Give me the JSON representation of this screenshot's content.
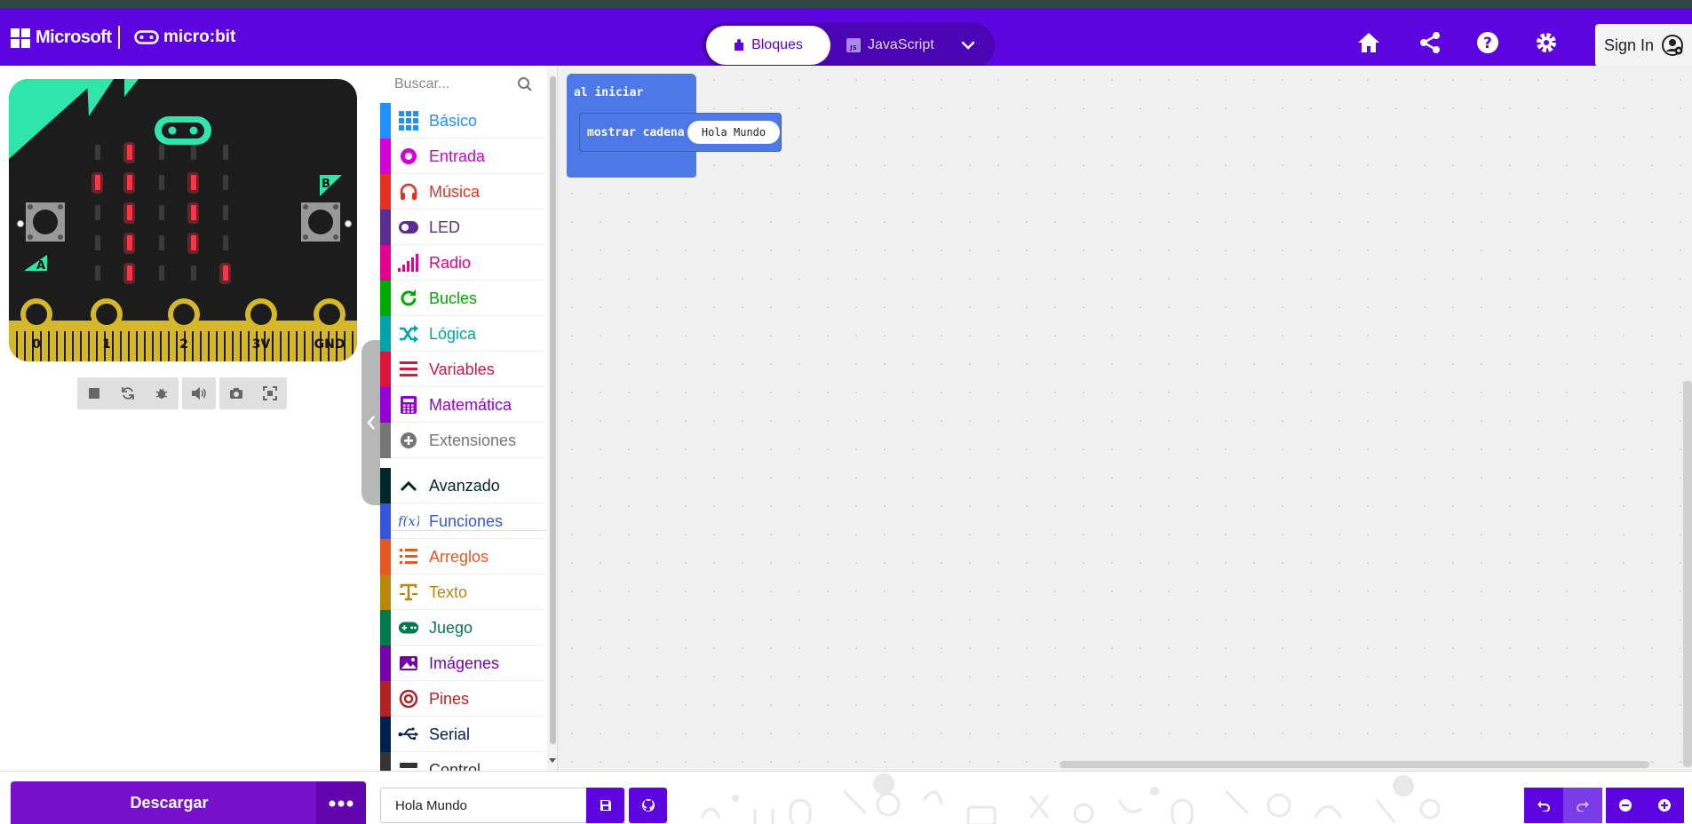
{
  "header": {
    "brand": "Microsoft",
    "product": "micro:bit",
    "modes": [
      {
        "label": "Bloques",
        "active": true
      },
      {
        "label": "JavaScript",
        "active": false
      }
    ],
    "sign_in": "Sign In",
    "icons": [
      "home-icon",
      "share-icon",
      "help-icon",
      "settings-icon",
      "user-icon"
    ]
  },
  "simulator": {
    "pins": [
      "0",
      "1",
      "2",
      "3V",
      "GND"
    ],
    "button_a": "A",
    "button_b": "B",
    "led_grid": [
      [
        0,
        1,
        0,
        0,
        0
      ],
      [
        1,
        1,
        0,
        1,
        0
      ],
      [
        0,
        1,
        0,
        1,
        0
      ],
      [
        0,
        1,
        0,
        1,
        0
      ],
      [
        0,
        1,
        0,
        0,
        1
      ]
    ],
    "controls": [
      "stop-icon",
      "restart-icon",
      "debug-icon",
      "sound-icon",
      "screenshot-icon",
      "fullscreen-icon"
    ]
  },
  "toolbox": {
    "search_placeholder": "Buscar...",
    "categories": [
      {
        "label": "Básico",
        "color": "#1e90ff",
        "icon": "grid-icon"
      },
      {
        "label": "Entrada",
        "color": "#d400d4",
        "icon": "target-icon"
      },
      {
        "label": "Música",
        "color": "#e63022",
        "icon": "headphones-icon"
      },
      {
        "label": "LED",
        "color": "#5c2d91",
        "icon": "toggle-icon"
      },
      {
        "label": "Radio",
        "color": "#e3008c",
        "icon": "signal-icon"
      },
      {
        "label": "Bucles",
        "color": "#00aa00",
        "icon": "refresh-icon"
      },
      {
        "label": "Lógica",
        "color": "#00a4a6",
        "icon": "shuffle-icon"
      },
      {
        "label": "Variables",
        "color": "#dc143c",
        "icon": "lines-icon"
      },
      {
        "label": "Matemática",
        "color": "#9400d3",
        "icon": "calculator-icon"
      },
      {
        "label": "Extensiones",
        "color": "#757575",
        "icon": "plus-circle-icon"
      },
      {
        "label": "Avanzado",
        "color": "#00272b",
        "icon": "chevron-up-icon"
      },
      {
        "label": "Funciones",
        "color": "#3455db",
        "icon": "function-icon"
      },
      {
        "label": "Arreglos",
        "color": "#e65722",
        "icon": "list-icon"
      },
      {
        "label": "Texto",
        "color": "#b8860b",
        "icon": "text-icon"
      },
      {
        "label": "Juego",
        "color": "#007a4b",
        "icon": "gamepad-icon"
      },
      {
        "label": "Imágenes",
        "color": "#7600a8",
        "icon": "image-icon"
      },
      {
        "label": "Pines",
        "color": "#b22222",
        "icon": "pin-icon"
      },
      {
        "label": "Serial",
        "color": "#002050",
        "icon": "usb-icon"
      },
      {
        "label": "Control",
        "color": "#333333",
        "icon": "server-icon"
      }
    ]
  },
  "workspace": {
    "on_start": "al iniciar",
    "show_string": "mostrar cadena",
    "string_value": "Hola Mundo"
  },
  "footer": {
    "download": "Descargar",
    "project_name": "Hola Mundo"
  }
}
